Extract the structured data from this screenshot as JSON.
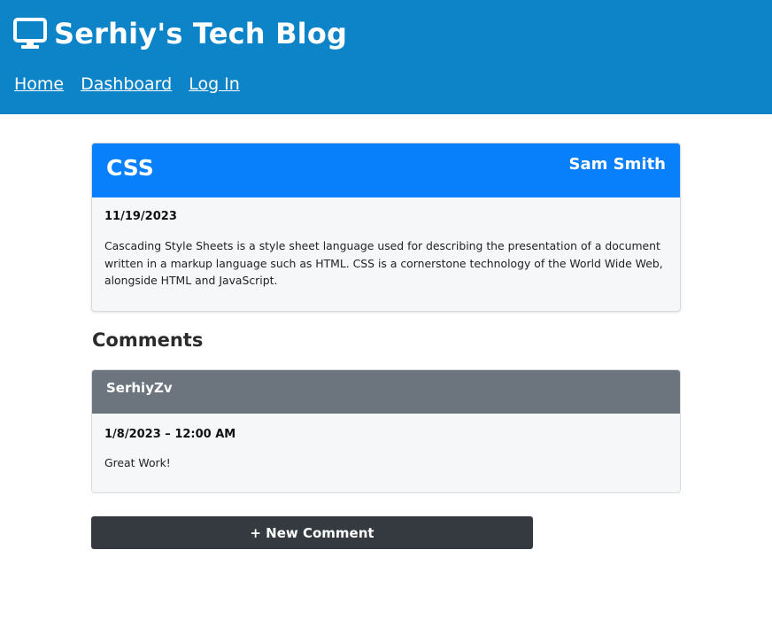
{
  "header": {
    "brand_icon": "monitor-icon",
    "title": "Serhiy's Tech Blog",
    "nav": [
      "Home",
      "Dashboard",
      "Log In"
    ],
    "background": "#0d84c8"
  },
  "post": {
    "title": "CSS",
    "author": "Sam Smith",
    "date": "11/19/2023",
    "body": "Cascading Style Sheets is a style sheet language used for describing the presentation of a document written in a markup language such as HTML. CSS is a cornerstone technology of the World Wide Web, alongside HTML and JavaScript.",
    "header_color": "#0880fc"
  },
  "comments_heading": "Comments",
  "comments": [
    {
      "author": "SerhiyZv",
      "date": "1/8/2023 – 12:00 AM",
      "body": "Great Work!",
      "header_color": "#6c757d"
    }
  ],
  "new_comment_button": "+ New Comment"
}
